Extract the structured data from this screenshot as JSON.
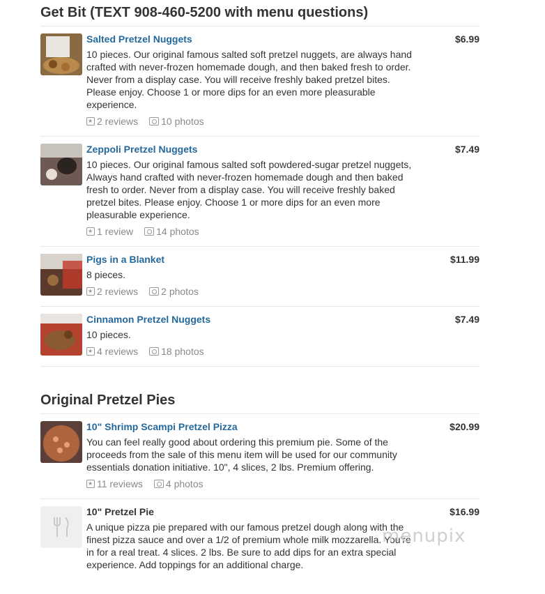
{
  "sections": [
    {
      "title": "Get Bit (TEXT 908-460-5200 with menu questions)",
      "items": [
        {
          "name": "Salted Pretzel Nuggets",
          "price": "$6.99",
          "desc": "10 pieces. Our original famous salted soft pretzel nuggets, are always hand crafted with never-frozen homemade dough, and then baked fresh to order. Never from a display case. You will receive freshly baked pretzel bites. Please enjoy. Choose 1 or more dips for an even more pleasurable experience.",
          "reviews": "2 reviews",
          "photos": "10 photos"
        },
        {
          "name": "Zeppoli Pretzel Nuggets",
          "price": "$7.49",
          "desc": "10 pieces. Our original famous salted soft powdered-sugar pretzel nuggets, Always hand crafted with never-frozen homemade dough and then baked fresh to order. Never from a display case. You will receive freshly baked pretzel bites. Please enjoy. Choose 1 or more dips for an even more pleasurable experience.",
          "reviews": "1 review",
          "photos": "14 photos"
        },
        {
          "name": "Pigs in a Blanket",
          "price": "$11.99",
          "desc": "8 pieces.",
          "reviews": "2 reviews",
          "photos": "2 photos"
        },
        {
          "name": "Cinnamon Pretzel Nuggets",
          "price": "$7.49",
          "desc": "10 pieces.",
          "reviews": "4 reviews",
          "photos": "18 photos"
        }
      ]
    },
    {
      "title": "Original Pretzel Pies",
      "items": [
        {
          "name": "10\" Shrimp Scampi Pretzel Pizza",
          "price": "$20.99",
          "desc": "You can feel really good about ordering this premium pie. Some of the proceeds from the sale of this menu item will be used for our community essentials donation initiative. 10\", 4 slices, 2 lbs. Premium offering.",
          "reviews": "11 reviews",
          "photos": "4 photos"
        },
        {
          "name": "10\" Pretzel Pie",
          "price": "$16.99",
          "desc": "A unique pizza pie prepared with our famous pretzel dough along with the finest pizza sauce and over a 1/2 of premium whole milk mozzarella. You're in for a real treat. 4 slices. 2 lbs. Be sure to add dips for an extra special experience. Add toppings for an additional charge."
        }
      ]
    }
  ],
  "watermark": "menupix",
  "icons": {
    "review": "star-box-icon",
    "photo": "camera-icon",
    "placeholder": "fork-knife-icon"
  }
}
